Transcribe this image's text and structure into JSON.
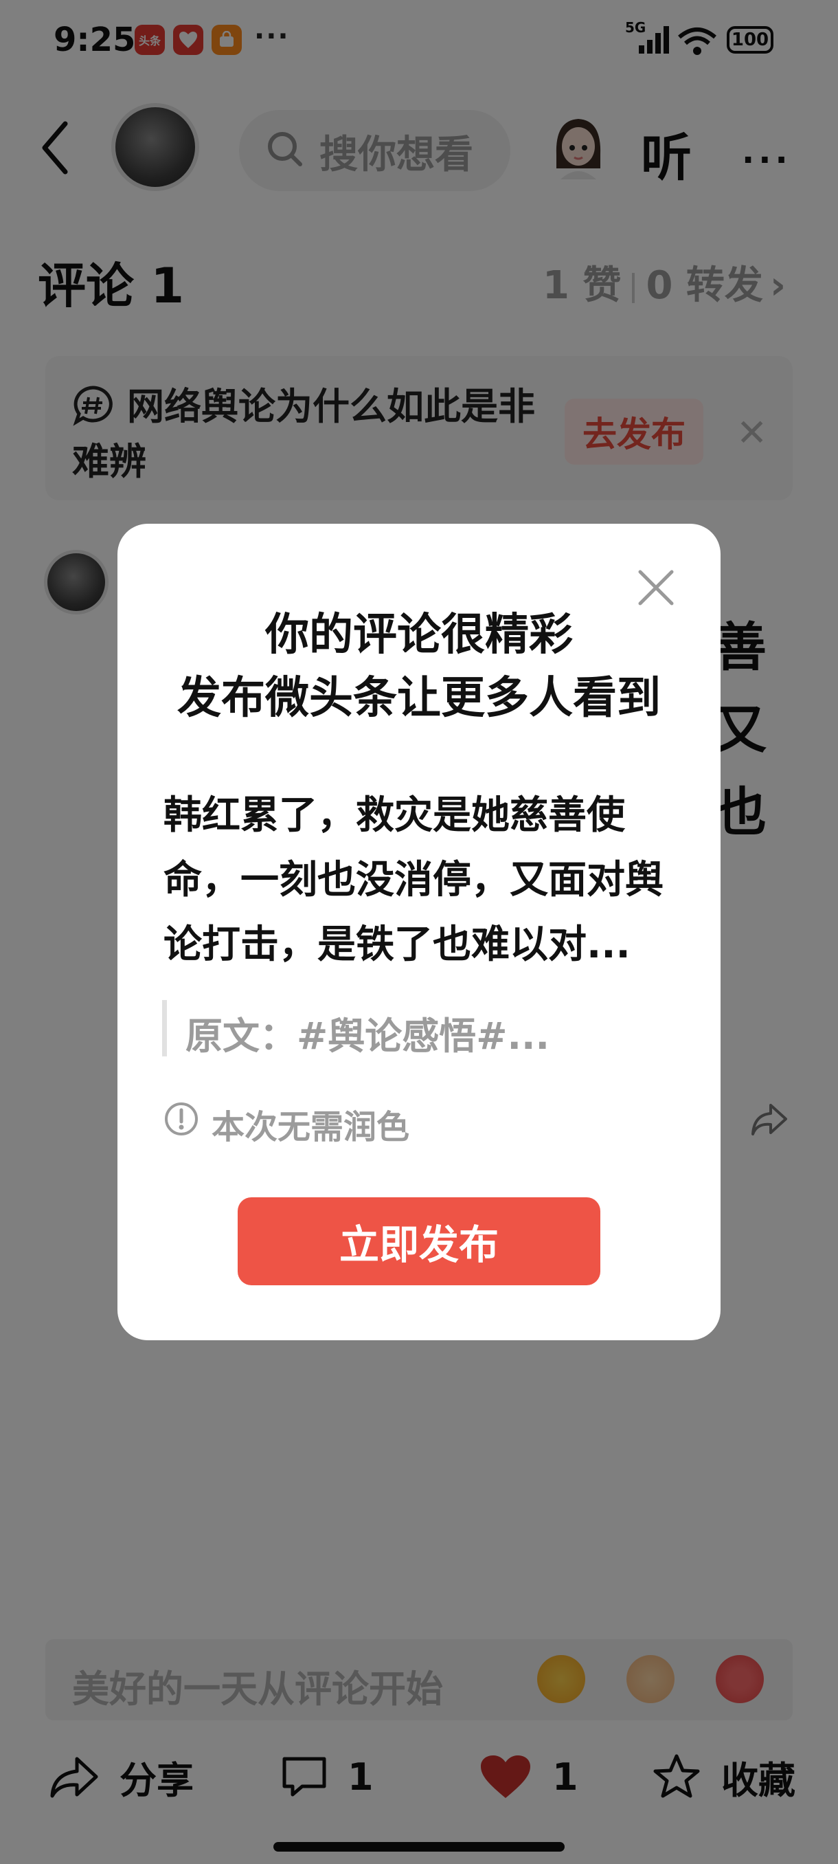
{
  "status_bar": {
    "time": "9:25",
    "apps": [
      {
        "label": "头条",
        "color": "#e63b32"
      },
      {
        "label": "",
        "color": "#e63b32"
      },
      {
        "label": "",
        "color": "#ff8a1c"
      }
    ],
    "more": "···",
    "network": "5G",
    "battery": "100"
  },
  "header": {
    "search_placeholder": "搜你想看",
    "listen_label": "听"
  },
  "comments": {
    "title": "评论 1",
    "likes": "1 赞",
    "reposts": "0 转发"
  },
  "topic_banner": {
    "text": "网络舆论为什么如此是非难辨",
    "action": "去发布"
  },
  "background_comment_glyphs": [
    "善",
    "又",
    "也"
  ],
  "comment_input": {
    "placeholder": "美好的一天从评论开始",
    "emojis": [
      "laughing-crying-emoji",
      "handshake-emoji",
      "flower-emoji"
    ]
  },
  "bottom_bar": {
    "share": "分享",
    "comment_count": "1",
    "like_count": "1",
    "favorite": "收藏"
  },
  "modal": {
    "title_line1": "你的评论很精彩",
    "title_line2": "发布微头条让更多人看到",
    "body": "韩红累了，救灾是她慈善使命，一刻也没消停，又面对舆论打击，是铁了也难以对...",
    "quote": "原文：#舆论感悟#...",
    "notice": "本次无需润色",
    "publish_button": "立即发布"
  },
  "colors": {
    "accent_red": "#ee5446",
    "heart_red": "#c9302c",
    "overlay": "rgba(0,0,0,0.5)"
  }
}
